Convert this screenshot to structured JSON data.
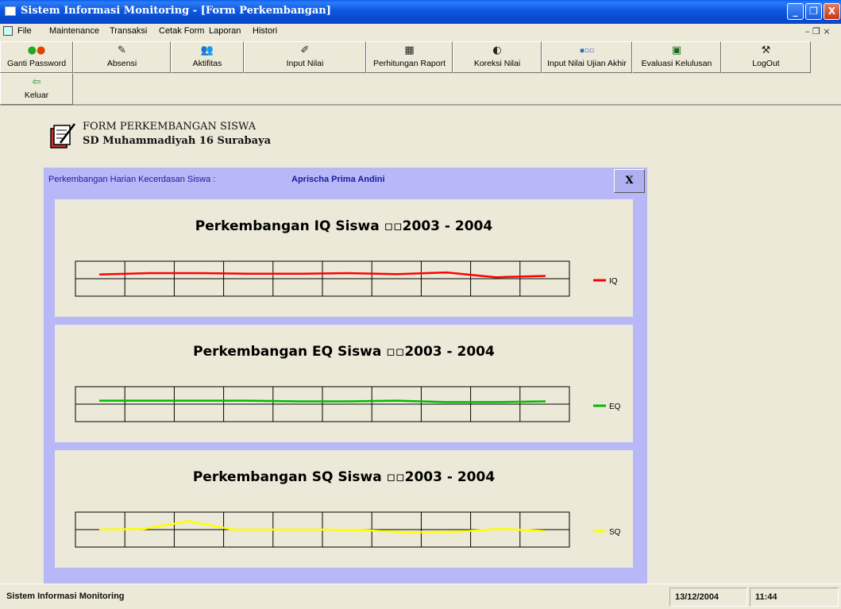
{
  "window": {
    "title": "Sistem Informasi Monitoring - [Form Perkembangan]",
    "minimize_glyph": "_",
    "maximize_glyph": "❐",
    "close_glyph": "X"
  },
  "menu": {
    "items": [
      "File",
      "Maintenance",
      "Transaksi",
      "Cetak Form",
      "Laporan",
      "Histori"
    ],
    "mdi_controls": "– ❐ ×"
  },
  "toolbar": {
    "buttons": [
      {
        "label": "Ganti Password",
        "icon": "key-icon"
      },
      {
        "label": "Absensi",
        "icon": "pen-icon"
      },
      {
        "label": "Aktifitas",
        "icon": "people-icon"
      },
      {
        "label": "Input Nilai",
        "icon": "edit-icon"
      },
      {
        "label": "Perhitungan Raport",
        "icon": "report-icon"
      },
      {
        "label": "Koreksi Nilai",
        "icon": "correction-icon"
      },
      {
        "label": "Input Nilai Ujian Akhir",
        "icon": "exam-icon"
      },
      {
        "label": "Evaluasi Kelulusan",
        "icon": "graduation-icon"
      },
      {
        "label": "LogOut",
        "icon": "tools-icon"
      },
      {
        "label": "Keluar",
        "icon": "exit-icon"
      }
    ]
  },
  "form": {
    "title": "FORM PERKEMBANGAN SISWA",
    "subtitle": "SD Muhammadiyah 16 Surabaya"
  },
  "panel": {
    "label": "Perkembangan Harian Kecerdasan Siswa  :",
    "student_name": "Aprischa Prima Andini",
    "close_label": "X"
  },
  "colors": {
    "iq": "#ff0000",
    "eq": "#00bb00",
    "sq": "#ffff00",
    "panel_bg": "#b8b8f8",
    "panel_text": "#1a1aa0"
  },
  "chart_data": [
    {
      "type": "line",
      "title": "Perkembangan IQ Siswa  ▫▫2003 - 2004",
      "legend": "IQ",
      "legend_position": "right",
      "grid": true,
      "ylim": [
        0,
        1
      ],
      "series": [
        {
          "name": "IQ",
          "values": [
            0.62,
            0.66,
            0.66,
            0.64,
            0.64,
            0.66,
            0.63,
            0.68,
            0.54,
            0.58
          ]
        }
      ]
    },
    {
      "type": "line",
      "title": "Perkembangan EQ Siswa  ▫▫2003 - 2004",
      "legend": "EQ",
      "legend_position": "right",
      "grid": true,
      "ylim": [
        0,
        1
      ],
      "series": [
        {
          "name": "EQ",
          "values": [
            0.6,
            0.6,
            0.6,
            0.6,
            0.58,
            0.58,
            0.6,
            0.56,
            0.56,
            0.58
          ]
        }
      ]
    },
    {
      "type": "line",
      "title": "Perkembangan SQ Siswa  ▫▫2003 - 2004",
      "legend": "SQ",
      "legend_position": "right",
      "grid": true,
      "ylim": [
        0,
        1
      ],
      "series": [
        {
          "name": "SQ",
          "values": [
            0.5,
            0.52,
            0.74,
            0.5,
            0.5,
            0.5,
            0.48,
            0.42,
            0.44,
            0.52,
            0.46
          ]
        }
      ]
    }
  ],
  "status": {
    "app_name": "Sistem Informasi Monitoring",
    "date": "13/12/2004",
    "time": "11:44"
  }
}
